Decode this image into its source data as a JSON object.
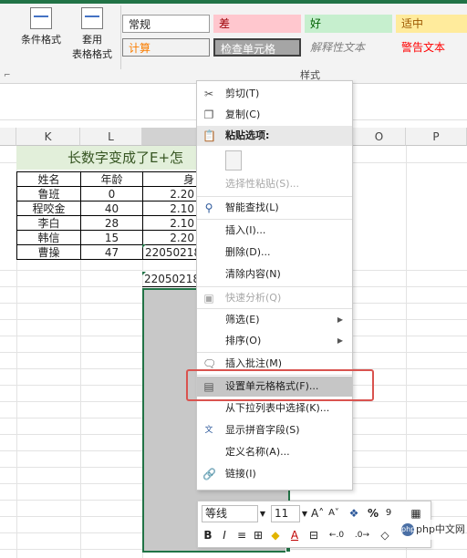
{
  "ribbon": {
    "conditional_format": "条件格式",
    "table_format_line1": "套用",
    "table_format_line2": "表格格式",
    "styles_group_label": "样式",
    "styles": {
      "normal": "常规",
      "bad": "差",
      "good": "好",
      "neutral": "适中",
      "calculation": "计算",
      "check_cell": "检查单元格",
      "explanatory": "解释性文本",
      "warning": "警告文本"
    }
  },
  "sheet": {
    "columns": [
      "K",
      "L",
      "O",
      "P"
    ],
    "title_text": "长数字变成了E+怎",
    "header_row": [
      "姓名",
      "年龄",
      "身"
    ],
    "rows": [
      [
        "鲁班",
        "0",
        "2.20"
      ],
      [
        "程咬金",
        "40",
        "2.10"
      ],
      [
        "李白",
        "28",
        "2.10"
      ],
      [
        "韩信",
        "15",
        "2.20"
      ],
      [
        "曹操",
        "47",
        "22050218"
      ]
    ],
    "extra_value": "22050218"
  },
  "context_menu": {
    "cut": "剪切(T)",
    "copy": "复制(C)",
    "paste_options": "粘贴选项:",
    "paste_special": "选择性粘贴(S)...",
    "smart_lookup": "智能查找(L)",
    "insert": "插入(I)...",
    "delete": "删除(D)...",
    "clear_contents": "清除内容(N)",
    "quick_analysis": "快速分析(Q)",
    "filter": "筛选(E)",
    "sort": "排序(O)",
    "insert_comment": "插入批注(M)",
    "format_cells": "设置单元格格式(F)...",
    "pick_from_list": "从下拉列表中选择(K)...",
    "phonetic": "显示拼音字段(S)",
    "define_name": "定义名称(A)...",
    "link": "链接(I)"
  },
  "mini_toolbar": {
    "font_name": "等线",
    "font_size": "11",
    "bold": "B",
    "italic": "I",
    "percent": "%"
  },
  "watermark": "php中文网",
  "colors": {
    "selection_gray": "#c8c8c8",
    "title_fill": "#e2efda",
    "highlight_red": "#d9534f",
    "excel_green": "#217346"
  }
}
